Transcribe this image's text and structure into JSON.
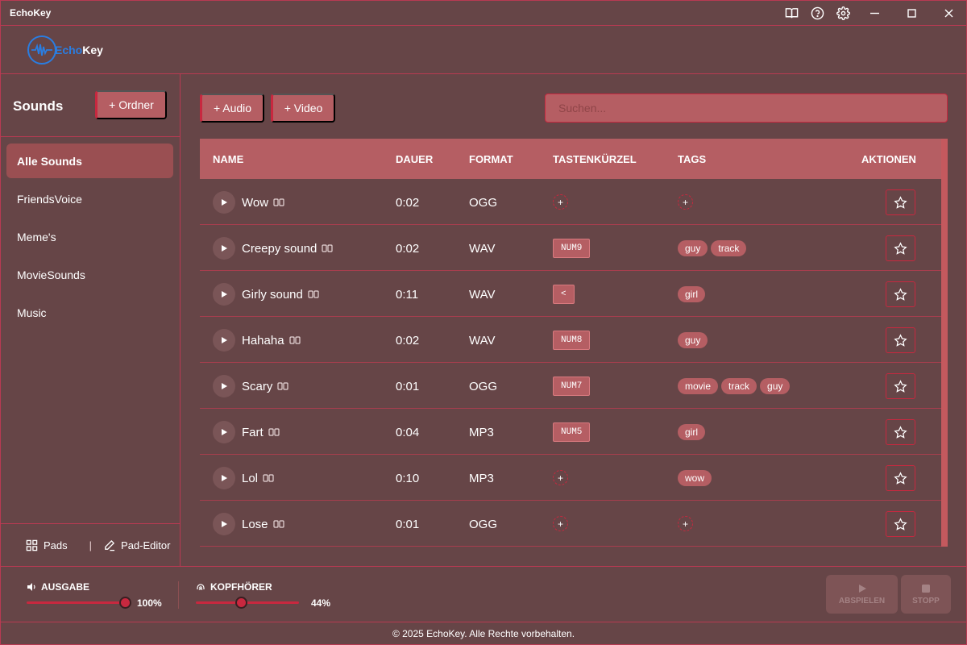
{
  "app": {
    "title": "EchoKey"
  },
  "titlebar": {
    "icons": [
      "book-icon",
      "help-icon",
      "settings-icon"
    ],
    "controls": [
      "minimize-icon",
      "maximize-icon",
      "close-icon"
    ]
  },
  "logo": {
    "text_a": "Echo",
    "text_b": "Key"
  },
  "sidebar": {
    "title": "Sounds",
    "add_folder_label": "+ Ordner",
    "items": [
      {
        "label": "Alle Sounds",
        "active": true
      },
      {
        "label": "FriendsVoice",
        "active": false
      },
      {
        "label": "Meme's",
        "active": false
      },
      {
        "label": "MovieSounds",
        "active": false
      },
      {
        "label": "Music",
        "active": false
      }
    ],
    "footer": {
      "pads_label": "Pads",
      "separator": "|",
      "editor_label": "Pad-Editor"
    }
  },
  "toolbar": {
    "add_audio_label": "+ Audio",
    "add_video_label": "+ Video",
    "search_placeholder": "Suchen..."
  },
  "table": {
    "columns": [
      "NAME",
      "DAUER",
      "FORMAT",
      "TASTENKÜRZEL",
      "TAGS",
      "AKTIONEN"
    ],
    "rows": [
      {
        "name": "Wow",
        "duration": "0:02",
        "format": "OGG",
        "hotkey": "",
        "tags": []
      },
      {
        "name": "Creepy sound",
        "duration": "0:02",
        "format": "WAV",
        "hotkey": "NUM9",
        "tags": [
          "guy",
          "track"
        ]
      },
      {
        "name": "Girly sound",
        "duration": "0:11",
        "format": "WAV",
        "hotkey": "<",
        "tags": [
          "girl"
        ]
      },
      {
        "name": "Hahaha",
        "duration": "0:02",
        "format": "WAV",
        "hotkey": "NUM8",
        "tags": [
          "guy"
        ]
      },
      {
        "name": "Scary",
        "duration": "0:01",
        "format": "OGG",
        "hotkey": "NUM7",
        "tags": [
          "movie",
          "track",
          "guy"
        ]
      },
      {
        "name": "Fart",
        "duration": "0:04",
        "format": "MP3",
        "hotkey": "NUM5",
        "tags": [
          "girl"
        ]
      },
      {
        "name": "Lol",
        "duration": "0:10",
        "format": "MP3",
        "hotkey": "",
        "tags": [
          "wow"
        ]
      },
      {
        "name": "Lose",
        "duration": "0:01",
        "format": "OGG",
        "hotkey": "",
        "tags": []
      }
    ]
  },
  "audio": {
    "output_label": "AUSGABE",
    "output_value": "100%",
    "output_level": 1.0,
    "headphones_label": "KOPFHÖRER",
    "headphones_value": "44%",
    "headphones_level": 0.44
  },
  "playback": {
    "play_label": "ABSPIELEN",
    "stop_label": "STOPP"
  },
  "footer": {
    "copyright": "© 2025 EchoKey. Alle Rechte vorbehalten."
  },
  "colors": {
    "background": "#664547",
    "accent": "#c8283f",
    "surface": "#b55e63",
    "logo_blue": "#2a7de1"
  }
}
